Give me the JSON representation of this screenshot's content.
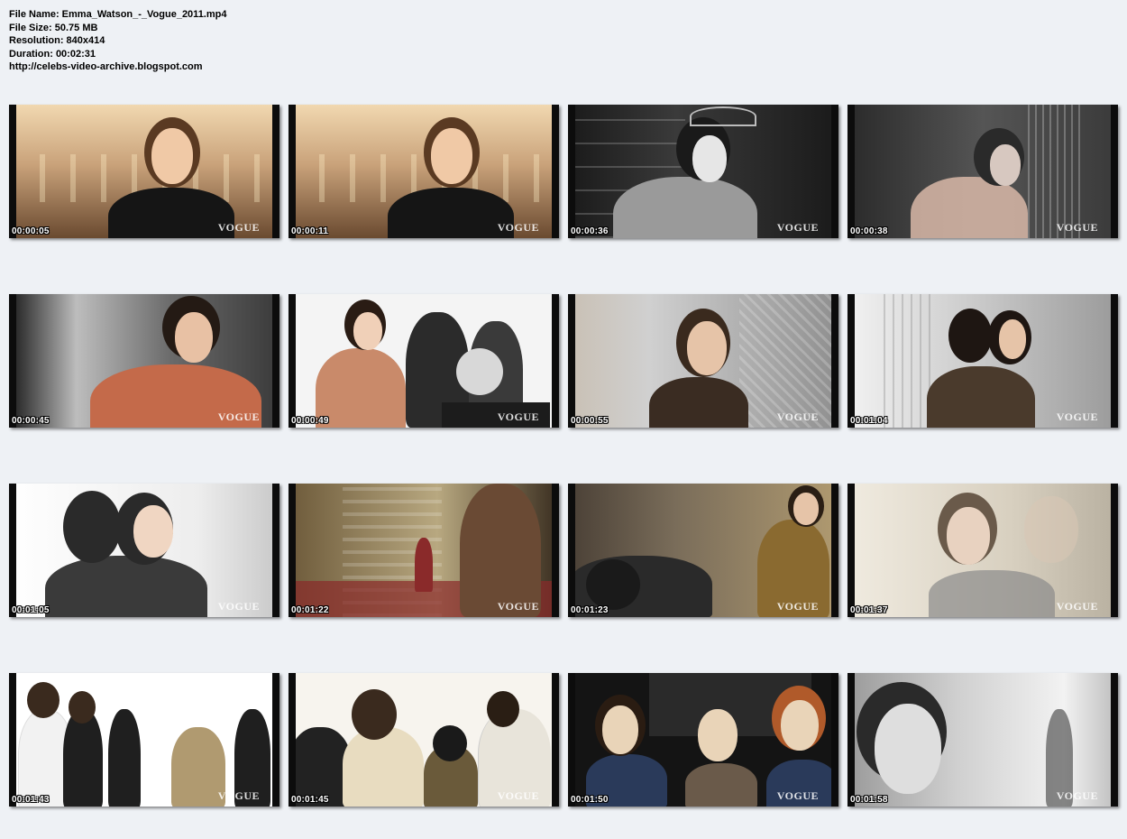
{
  "info": {
    "file_name": "File Name: Emma_Watson_-_Vogue_2011.mp4",
    "file_size": "File Size: 50.75 MB",
    "resolution": "Resolution: 840x414",
    "duration": "Duration: 00:02:31",
    "url": "http://celebs-video-archive.blogspot.com"
  },
  "watermark": "VOGUE",
  "thumbnails": [
    {
      "time": "00:00:05",
      "scene": "warm-ballroom",
      "palette": [
        "#c9a27a",
        "#f1d8b0",
        "#6a4a30"
      ]
    },
    {
      "time": "00:00:11",
      "scene": "warm-ballroom",
      "palette": [
        "#c9a27a",
        "#f1d8b0",
        "#6a4a30"
      ]
    },
    {
      "time": "00:00:36",
      "scene": "bw-window",
      "palette": [
        "#1a1a1a",
        "#9a9a9a",
        "#e6e6e6"
      ]
    },
    {
      "time": "00:00:38",
      "scene": "dim-mirror",
      "palette": [
        "#2a2a2a",
        "#a8a8a8",
        "#d9b8a8"
      ]
    },
    {
      "time": "00:00:45",
      "scene": "silver-wall",
      "palette": [
        "#3a3a3a",
        "#bdbdbd",
        "#c46a4a"
      ]
    },
    {
      "time": "00:00:49",
      "scene": "studio-crew",
      "palette": [
        "#f4f4f4",
        "#2b2b2b",
        "#c98a6a"
      ]
    },
    {
      "time": "00:00:55",
      "scene": "foil-wall",
      "palette": [
        "#8f8f8f",
        "#d0d0d0",
        "#3a2c22"
      ]
    },
    {
      "time": "00:01:04",
      "scene": "mirror-room",
      "palette": [
        "#c8c8c8",
        "#f2f2f2",
        "#4a3a2c"
      ]
    },
    {
      "time": "00:01:05",
      "scene": "white-profile",
      "palette": [
        "#ededed",
        "#ffffff",
        "#2a2a2a"
      ]
    },
    {
      "time": "00:01:22",
      "scene": "gold-column",
      "palette": [
        "#6d5a3a",
        "#b8a880",
        "#8a2a2a"
      ]
    },
    {
      "time": "00:01:23",
      "scene": "gold-dress",
      "palette": [
        "#7a6d5a",
        "#b09a70",
        "#2a2a2a"
      ]
    },
    {
      "time": "00:01:37",
      "scene": "fade-portrait",
      "palette": [
        "#d8d0c0",
        "#f0ebe0",
        "#6a5a4a"
      ]
    },
    {
      "time": "00:01:43",
      "scene": "waiters",
      "palette": [
        "#f2f2f2",
        "#ffffff",
        "#1f1f1f"
      ]
    },
    {
      "time": "00:01:45",
      "scene": "waiters-close",
      "palette": [
        "#e8e4da",
        "#f7f4ee",
        "#222222"
      ]
    },
    {
      "time": "00:01:50",
      "scene": "premiere",
      "palette": [
        "#141414",
        "#2a3a5a",
        "#e9d4b8"
      ]
    },
    {
      "time": "00:01:58",
      "scene": "bw-closeup",
      "palette": [
        "#cfcfcf",
        "#f2f2f2",
        "#2a2a2a"
      ]
    }
  ]
}
